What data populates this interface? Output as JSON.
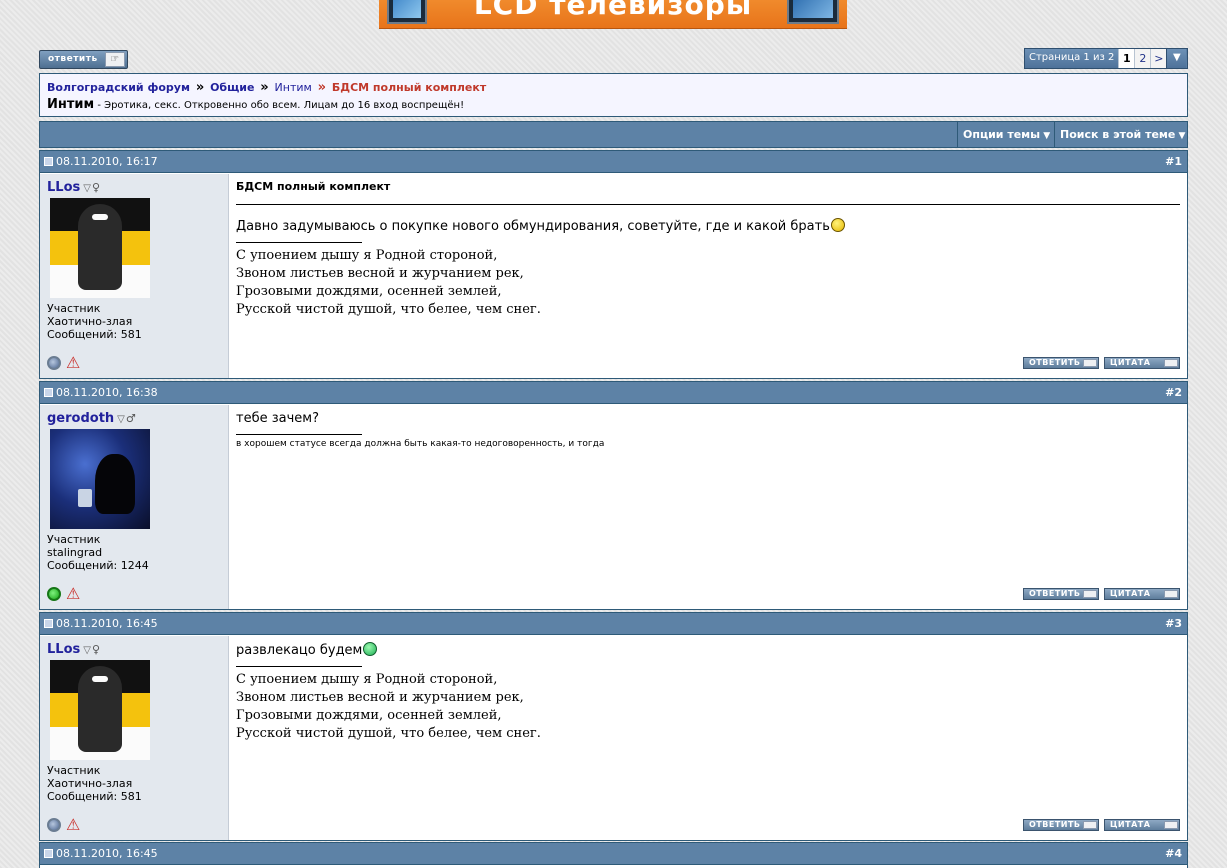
{
  "banner": {
    "text": "LCD телевизоры"
  },
  "top": {
    "reply_label": "ответить"
  },
  "pager": {
    "label": "Страница 1 из 2",
    "pages": [
      "1",
      "2"
    ],
    "next": ">"
  },
  "breadcrumb": {
    "items": [
      "Волгоградский форум",
      "Общие",
      "Интим"
    ],
    "separator": "»",
    "current": "БДСМ полный комплект"
  },
  "forum": {
    "name": "Интим",
    "description": " - Эротика, секс. Откровенно обо всем. Лицам до 16 вход воспрещён!"
  },
  "toolbar": {
    "thread_options": "Опции темы",
    "search_thread": "Поиск в этой теме"
  },
  "post_buttons": {
    "reply": "ответить",
    "quote": "цитата"
  },
  "signatures": {
    "llos": [
      "С упоением дышу я Родной стороной,",
      "Звоном листьев весной и журчанием рек,",
      "Грозовыми дождями, осенней землей,",
      "Русской чистой душой, что белее, чем снег."
    ],
    "gerodoth": "в хорошем статусе всегда должна быть какая-то недоговоренность, и тогда"
  },
  "posts": [
    {
      "date": "08.11.2010, 16:17",
      "number": "#1",
      "user": {
        "name": "LLos",
        "title": "Участник",
        "subtitle": "Хаотично-злая",
        "posts": "Сообщений: 581",
        "sex": "♀"
      },
      "title": "БДСМ полный комплект",
      "text": "Давно задумываюсь о покупке нового обмундирования, советуйте, где и какой брать"
    },
    {
      "date": "08.11.2010, 16:38",
      "number": "#2",
      "user": {
        "name": "gerodoth",
        "title": "Участник",
        "subtitle": "stalingrad",
        "posts": "Сообщений: 1244",
        "sex": "♂"
      },
      "text": "тебе зачем?"
    },
    {
      "date": "08.11.2010, 16:45",
      "number": "#3",
      "user": {
        "name": "LLos",
        "title": "Участник",
        "subtitle": "Хаотично-злая",
        "posts": "Сообщений: 581",
        "sex": "♀"
      },
      "text": "развлекацо будем"
    },
    {
      "date": "08.11.2010, 16:45",
      "number": "#4"
    }
  ],
  "colors": {
    "header_bar": "#5d82a6",
    "border": "#2e5a78",
    "userinfo_bg": "#e3e8ee",
    "link": "#22229c",
    "current_crumb": "#c0392b"
  },
  "icons": {
    "triangle": "▽",
    "warning": "⚠"
  }
}
